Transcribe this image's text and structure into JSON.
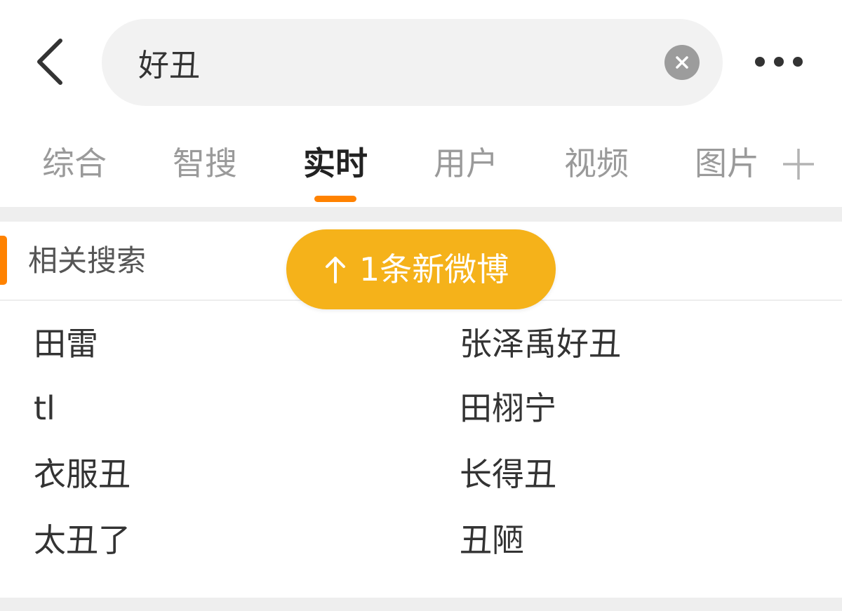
{
  "header": {
    "back_icon": "back-chevron-icon",
    "search_value": "好丑",
    "clear_icon": "clear-icon",
    "more_icon": "more-dots-icon"
  },
  "tabs": {
    "items": [
      {
        "label": "综合",
        "active": false
      },
      {
        "label": "智搜",
        "active": false
      },
      {
        "label": "实时",
        "active": true
      },
      {
        "label": "用户",
        "active": false
      },
      {
        "label": "视频",
        "active": false
      },
      {
        "label": "图片",
        "active": false
      }
    ],
    "add_icon": "plus-icon",
    "indicator_color": "#ff8200"
  },
  "related": {
    "title": "相关搜索",
    "marker_color": "#ff8200",
    "left_items": [
      "田雷",
      "tl",
      "衣服丑",
      "太丑了"
    ],
    "right_items": [
      "张泽禹好丑",
      "田栩宁",
      "长得丑",
      "丑陋"
    ]
  },
  "new_post_pill": {
    "icon": "arrow-up-icon",
    "text": "1条新微博",
    "background_color": "#f5b21a"
  }
}
